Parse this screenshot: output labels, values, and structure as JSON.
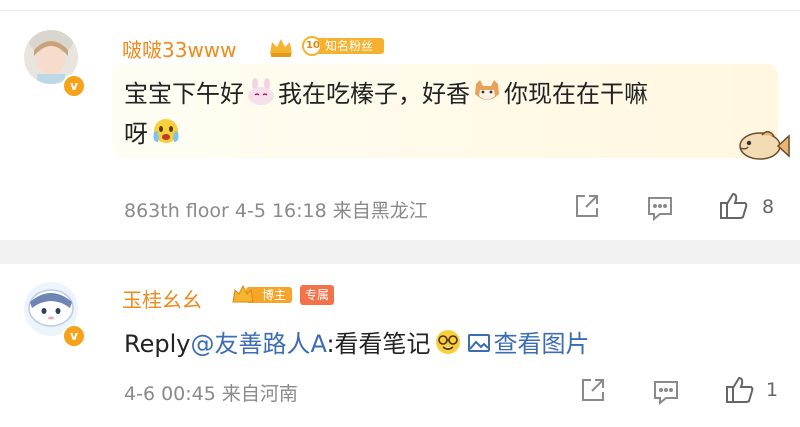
{
  "comments": [
    {
      "username": "啵啵33www",
      "fan_badge": {
        "level": "10",
        "label": "知名粉丝"
      },
      "content": {
        "part1": "宝宝下午好",
        "part2": "我在吃榛子，好香",
        "part3": "你现在在干嘛",
        "part4": "呀"
      },
      "floor": "863th floor",
      "date": "4-5 16:18",
      "location": "来自黑龙江",
      "like_count": "8"
    },
    {
      "username": "玉桂幺幺",
      "badges": {
        "blogger": "博主",
        "exclusive": "专属"
      },
      "content": {
        "reply_prefix": "Reply",
        "mention": "@友善路人A",
        "text": ":看看笔记",
        "image_link": "查看图片"
      },
      "date": "4-6 00:45",
      "location": "来自河南",
      "like_count": "1"
    }
  ],
  "icons": {
    "share": "share-icon",
    "comment": "comment-icon",
    "like": "thumbs-up-icon",
    "verified": "verified-v-icon"
  },
  "colors": {
    "username": "#f08a1d",
    "mention": "#3c6cb3",
    "meta": "#8a8a8a",
    "badge_orange": "#f7a21b",
    "exclusive_tag": "#f3724c"
  }
}
